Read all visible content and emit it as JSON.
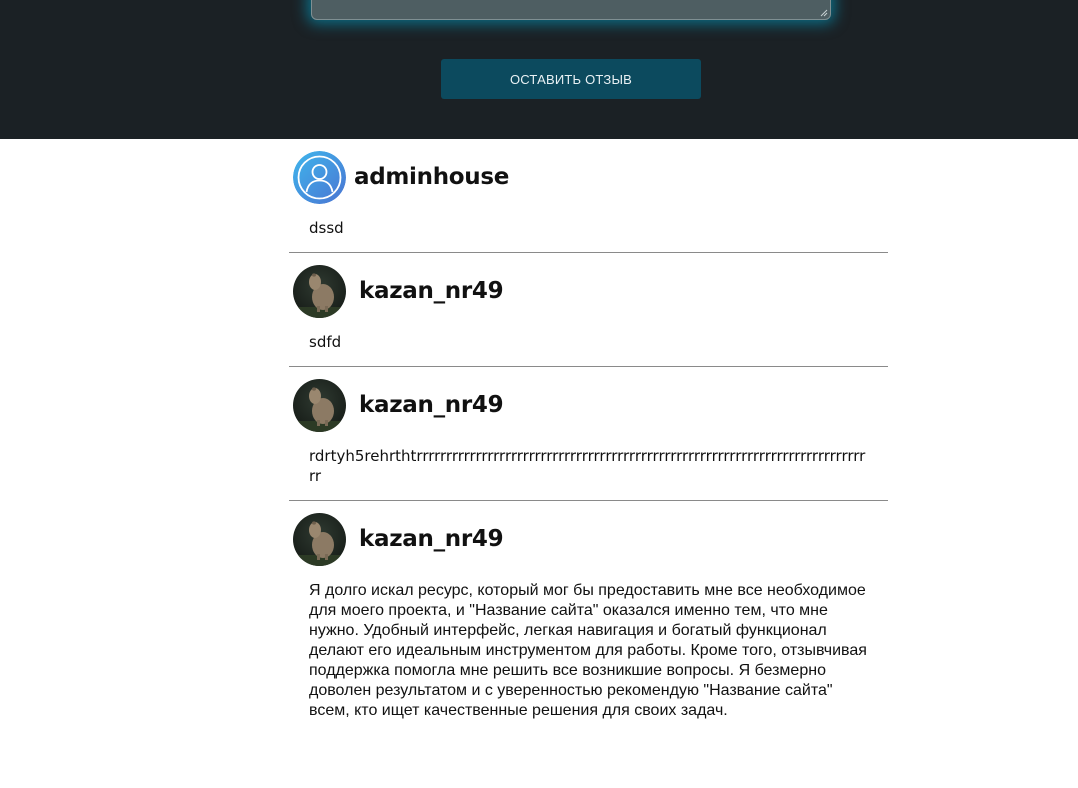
{
  "form": {
    "submit_label": "ОСТАВИТЬ ОТЗЫВ"
  },
  "reviews": [
    {
      "username": "adminhouse",
      "avatar": "default-user-icon",
      "text": "dssd"
    },
    {
      "username": "kazan_nr49",
      "avatar": "capybara-photo",
      "text": "sdfd"
    },
    {
      "username": "kazan_nr49",
      "avatar": "capybara-photo",
      "text": "rdrtyh5rehrthtrrrrrrrrrrrrrrrrrrrrrrrrrrrrrrrrrrrrrrrrrrrrrrrrrrrrrrrrrrrrrrrrrrrrrrrrrrrrrr"
    },
    {
      "username": "kazan_nr49",
      "avatar": "capybara-photo",
      "text": "Я долго искал ресурс, который мог бы предоставить мне все необходимое для моего проекта, и \"Название сайта\" оказался именно тем, что мне нужно. Удобный интерфейс, легкая навигация и богатый функционал делают его идеальным инструментом для работы. Кроме того, отзывчивая поддержка помогла мне решить все возникшие вопросы. Я безмерно доволен результатом и с уверенностью рекомендую \"Название сайта\" всем, кто ищет качественные решения для своих задач."
    }
  ],
  "colors": {
    "header_bg": "#1b2125",
    "button_bg": "#0c4a5e",
    "textarea_bg": "#4e5e62",
    "textarea_glow": "#00aad2",
    "divider": "#8a8a8a"
  }
}
